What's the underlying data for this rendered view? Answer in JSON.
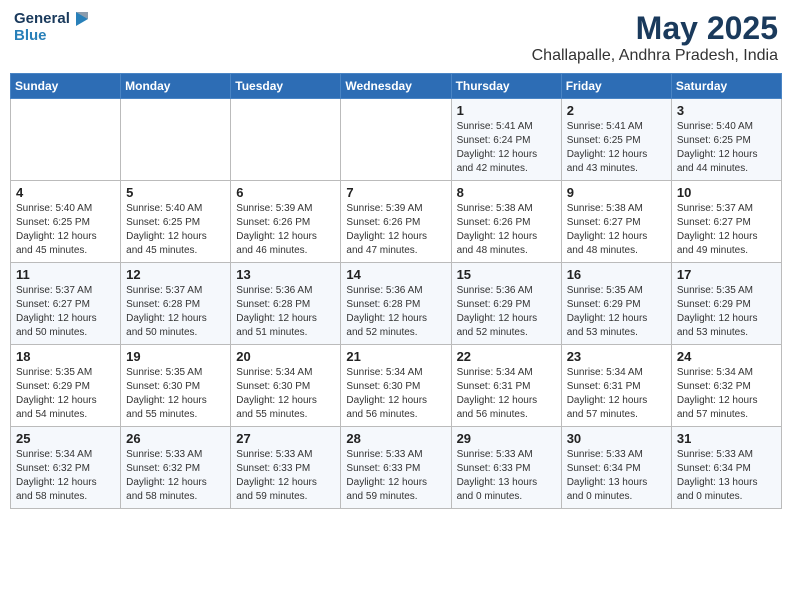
{
  "logo": {
    "line1": "General",
    "line2": "Blue"
  },
  "title": "May 2025",
  "location": "Challapalle, Andhra Pradesh, India",
  "weekdays": [
    "Sunday",
    "Monday",
    "Tuesday",
    "Wednesday",
    "Thursday",
    "Friday",
    "Saturday"
  ],
  "weeks": [
    [
      {
        "day": "",
        "info": ""
      },
      {
        "day": "",
        "info": ""
      },
      {
        "day": "",
        "info": ""
      },
      {
        "day": "",
        "info": ""
      },
      {
        "day": "1",
        "info": "Sunrise: 5:41 AM\nSunset: 6:24 PM\nDaylight: 12 hours\nand 42 minutes."
      },
      {
        "day": "2",
        "info": "Sunrise: 5:41 AM\nSunset: 6:25 PM\nDaylight: 12 hours\nand 43 minutes."
      },
      {
        "day": "3",
        "info": "Sunrise: 5:40 AM\nSunset: 6:25 PM\nDaylight: 12 hours\nand 44 minutes."
      }
    ],
    [
      {
        "day": "4",
        "info": "Sunrise: 5:40 AM\nSunset: 6:25 PM\nDaylight: 12 hours\nand 45 minutes."
      },
      {
        "day": "5",
        "info": "Sunrise: 5:40 AM\nSunset: 6:25 PM\nDaylight: 12 hours\nand 45 minutes."
      },
      {
        "day": "6",
        "info": "Sunrise: 5:39 AM\nSunset: 6:26 PM\nDaylight: 12 hours\nand 46 minutes."
      },
      {
        "day": "7",
        "info": "Sunrise: 5:39 AM\nSunset: 6:26 PM\nDaylight: 12 hours\nand 47 minutes."
      },
      {
        "day": "8",
        "info": "Sunrise: 5:38 AM\nSunset: 6:26 PM\nDaylight: 12 hours\nand 48 minutes."
      },
      {
        "day": "9",
        "info": "Sunrise: 5:38 AM\nSunset: 6:27 PM\nDaylight: 12 hours\nand 48 minutes."
      },
      {
        "day": "10",
        "info": "Sunrise: 5:37 AM\nSunset: 6:27 PM\nDaylight: 12 hours\nand 49 minutes."
      }
    ],
    [
      {
        "day": "11",
        "info": "Sunrise: 5:37 AM\nSunset: 6:27 PM\nDaylight: 12 hours\nand 50 minutes."
      },
      {
        "day": "12",
        "info": "Sunrise: 5:37 AM\nSunset: 6:28 PM\nDaylight: 12 hours\nand 50 minutes."
      },
      {
        "day": "13",
        "info": "Sunrise: 5:36 AM\nSunset: 6:28 PM\nDaylight: 12 hours\nand 51 minutes."
      },
      {
        "day": "14",
        "info": "Sunrise: 5:36 AM\nSunset: 6:28 PM\nDaylight: 12 hours\nand 52 minutes."
      },
      {
        "day": "15",
        "info": "Sunrise: 5:36 AM\nSunset: 6:29 PM\nDaylight: 12 hours\nand 52 minutes."
      },
      {
        "day": "16",
        "info": "Sunrise: 5:35 AM\nSunset: 6:29 PM\nDaylight: 12 hours\nand 53 minutes."
      },
      {
        "day": "17",
        "info": "Sunrise: 5:35 AM\nSunset: 6:29 PM\nDaylight: 12 hours\nand 53 minutes."
      }
    ],
    [
      {
        "day": "18",
        "info": "Sunrise: 5:35 AM\nSunset: 6:29 PM\nDaylight: 12 hours\nand 54 minutes."
      },
      {
        "day": "19",
        "info": "Sunrise: 5:35 AM\nSunset: 6:30 PM\nDaylight: 12 hours\nand 55 minutes."
      },
      {
        "day": "20",
        "info": "Sunrise: 5:34 AM\nSunset: 6:30 PM\nDaylight: 12 hours\nand 55 minutes."
      },
      {
        "day": "21",
        "info": "Sunrise: 5:34 AM\nSunset: 6:30 PM\nDaylight: 12 hours\nand 56 minutes."
      },
      {
        "day": "22",
        "info": "Sunrise: 5:34 AM\nSunset: 6:31 PM\nDaylight: 12 hours\nand 56 minutes."
      },
      {
        "day": "23",
        "info": "Sunrise: 5:34 AM\nSunset: 6:31 PM\nDaylight: 12 hours\nand 57 minutes."
      },
      {
        "day": "24",
        "info": "Sunrise: 5:34 AM\nSunset: 6:32 PM\nDaylight: 12 hours\nand 57 minutes."
      }
    ],
    [
      {
        "day": "25",
        "info": "Sunrise: 5:34 AM\nSunset: 6:32 PM\nDaylight: 12 hours\nand 58 minutes."
      },
      {
        "day": "26",
        "info": "Sunrise: 5:33 AM\nSunset: 6:32 PM\nDaylight: 12 hours\nand 58 minutes."
      },
      {
        "day": "27",
        "info": "Sunrise: 5:33 AM\nSunset: 6:33 PM\nDaylight: 12 hours\nand 59 minutes."
      },
      {
        "day": "28",
        "info": "Sunrise: 5:33 AM\nSunset: 6:33 PM\nDaylight: 12 hours\nand 59 minutes."
      },
      {
        "day": "29",
        "info": "Sunrise: 5:33 AM\nSunset: 6:33 PM\nDaylight: 13 hours\nand 0 minutes."
      },
      {
        "day": "30",
        "info": "Sunrise: 5:33 AM\nSunset: 6:34 PM\nDaylight: 13 hours\nand 0 minutes."
      },
      {
        "day": "31",
        "info": "Sunrise: 5:33 AM\nSunset: 6:34 PM\nDaylight: 13 hours\nand 0 minutes."
      }
    ]
  ]
}
